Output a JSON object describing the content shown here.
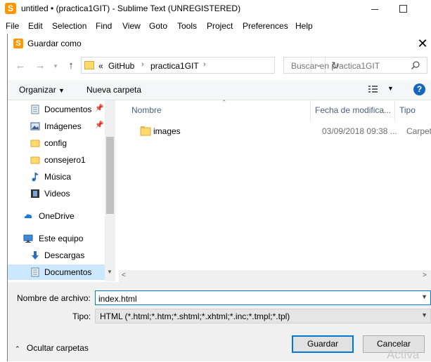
{
  "app": {
    "title": "untitled • (practica1GIT) - Sublime Text (UNREGISTERED)",
    "menu": [
      "File",
      "Edit",
      "Selection",
      "Find",
      "View",
      "Goto",
      "Tools",
      "Project",
      "Preferences",
      "Help"
    ]
  },
  "dialog": {
    "title": "Guardar como",
    "address": {
      "overflow": "«",
      "crumbs": [
        "GitHub",
        "practica1GIT"
      ]
    },
    "search_placeholder": "Buscar en practica1GIT",
    "toolbar": {
      "organize": "Organizar",
      "new_folder": "Nueva carpeta"
    },
    "nav_items": [
      {
        "label": "Documentos",
        "icon": "documents-icon",
        "pinned": true
      },
      {
        "label": "Imágenes",
        "icon": "pictures-icon",
        "pinned": true
      },
      {
        "label": "config",
        "icon": "folder-icon",
        "pinned": false
      },
      {
        "label": "consejero1",
        "icon": "folder-icon",
        "pinned": false
      },
      {
        "label": "Música",
        "icon": "music-icon",
        "pinned": false
      },
      {
        "label": "Videos",
        "icon": "videos-icon",
        "pinned": false
      },
      {
        "label": "OneDrive",
        "icon": "onedrive-icon",
        "pinned": false
      },
      {
        "label": "Este equipo",
        "icon": "computer-icon",
        "pinned": false
      },
      {
        "label": "Descargas",
        "icon": "downloads-icon",
        "pinned": false
      },
      {
        "label": "Documentos",
        "icon": "documents-icon",
        "pinned": false,
        "selected": true
      }
    ],
    "columns": [
      "Nombre",
      "Fecha de modifica...",
      "Tipo"
    ],
    "files": [
      {
        "name": "images",
        "date": "03/09/2018 09:38 ...",
        "type": "Carpeta d"
      }
    ],
    "form": {
      "filename_label": "Nombre de archivo:",
      "filename_value": "index.html",
      "type_label": "Tipo:",
      "type_value": "HTML (*.html;*.htm;*.shtml;*.xhtml;*.inc;*.tmpl;*.tpl)"
    },
    "hide_folders": "Ocultar carpetas",
    "save_label": "Guardar",
    "cancel_label": "Cancelar"
  },
  "watermark": "Activa",
  "colors": {
    "accent": "#0078d7",
    "selection": "#cce8ff",
    "folder": "#ffd86e",
    "sublime": "#ff9800"
  }
}
